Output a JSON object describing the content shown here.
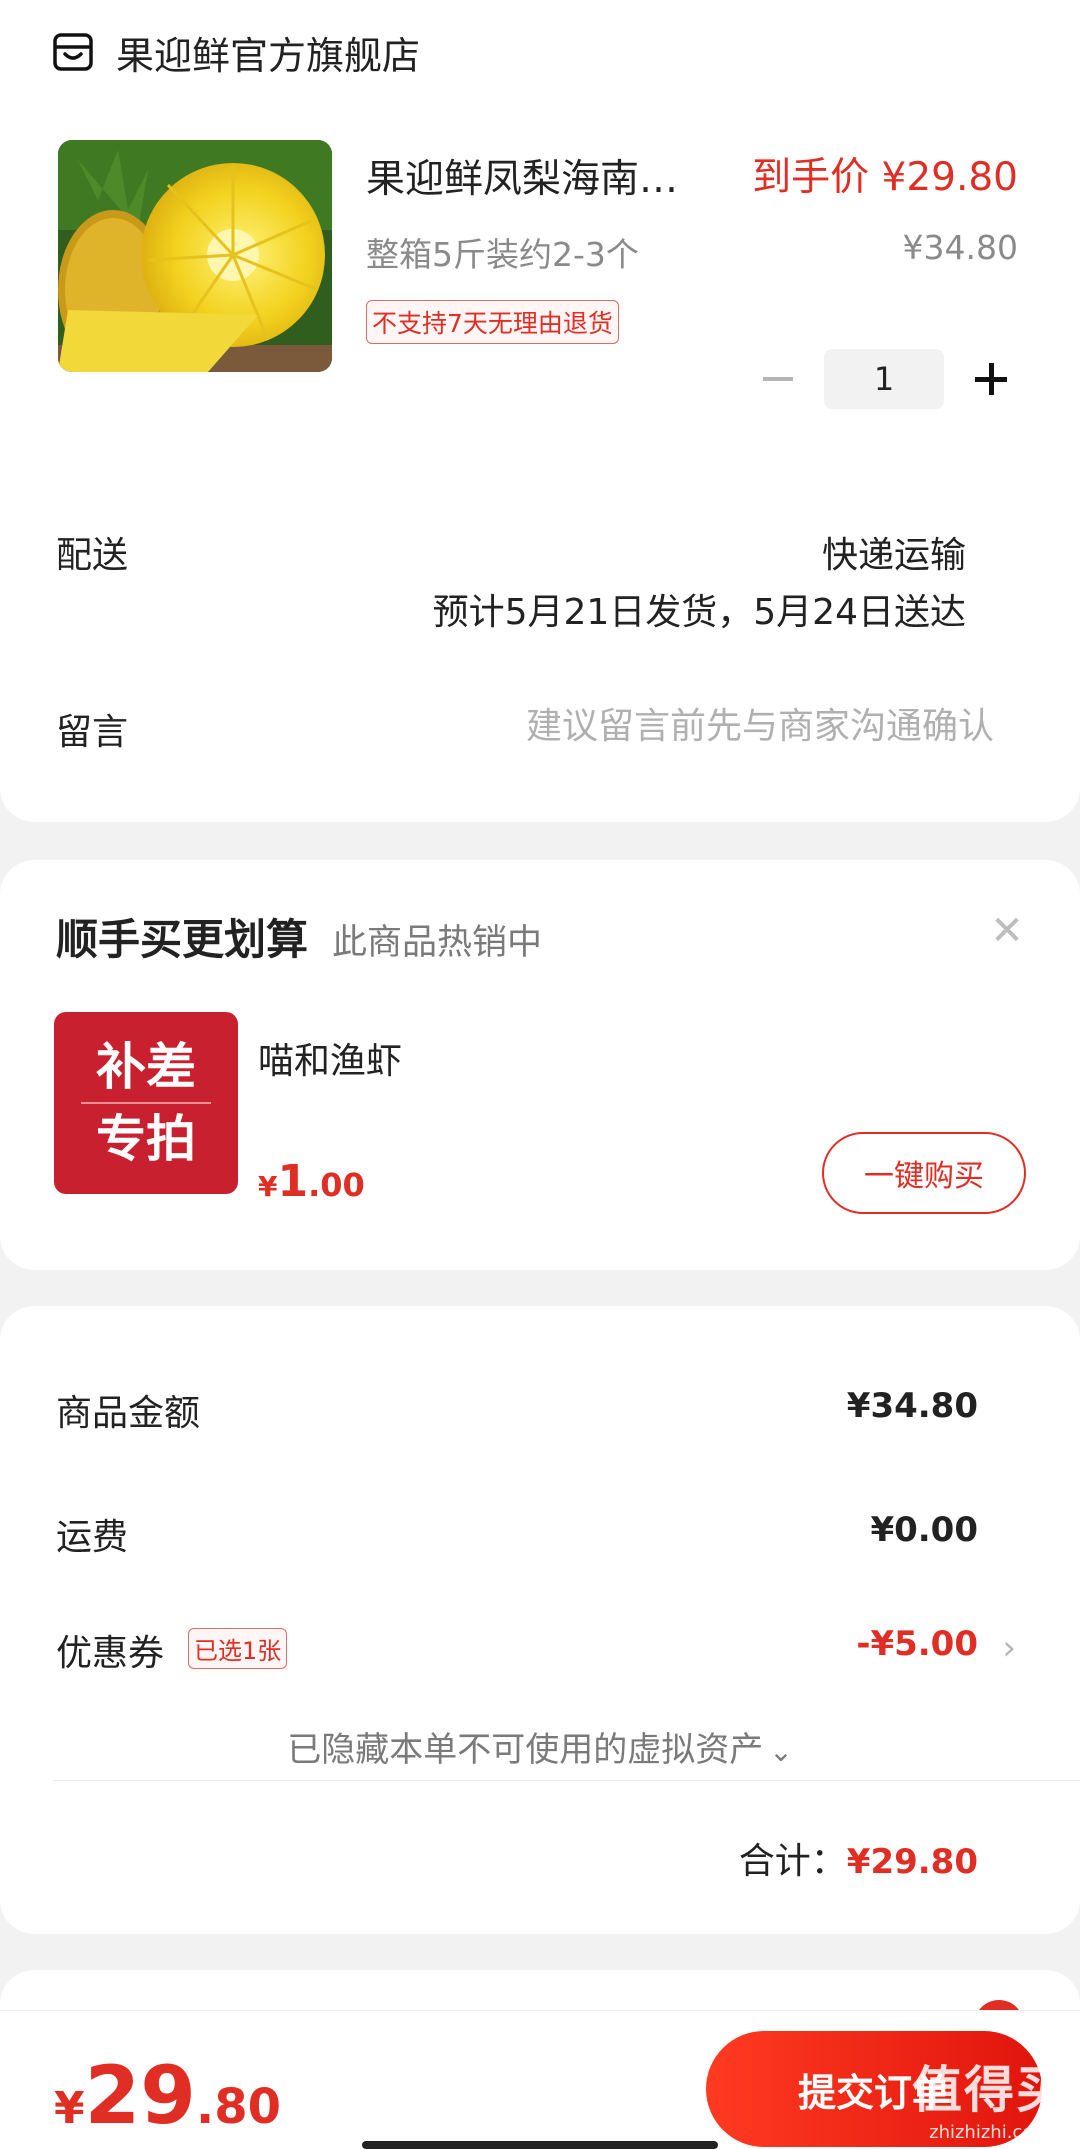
{
  "store": {
    "name": "果迎鲜官方旗舰店",
    "icon": "store-icon"
  },
  "product": {
    "title": "果迎鲜凤梨海南…",
    "final_price": "到手价 ¥29.80",
    "spec": "整箱5斤装约2-3个",
    "original_price": "¥34.80",
    "tag": "不支持7天无理由退货",
    "quantity": "1"
  },
  "delivery": {
    "label": "配送",
    "method": "快递运输",
    "estimate": "预计5月21日发货，5月24日送达"
  },
  "message": {
    "label": "留言",
    "placeholder": "建议留言前先与商家沟通确认"
  },
  "upsell": {
    "title": "顺手买更划算",
    "subtitle": "此商品热销中",
    "thumb_line1": "补差",
    "thumb_line2": "专拍",
    "item_name": "喵和渔虾",
    "price_currency": "¥",
    "price_int": "1",
    "price_dec": ".00",
    "button": "一键购买"
  },
  "summary": {
    "goods_label": "商品金额",
    "goods_value": "¥34.80",
    "shipping_label": "运费",
    "shipping_value": "¥0.00",
    "coupon_label": "优惠券",
    "coupon_tag": "已选1张",
    "coupon_value": "-¥5.00",
    "hidden_note": "已隐藏本单不可使用的虚拟资产",
    "total_label": "合计：",
    "total_value": "¥29.80"
  },
  "bottom": {
    "currency": "¥",
    "amount_int": "29",
    "amount_dec": ".80",
    "submit": "提交订单"
  },
  "watermark": {
    "big": "值得买",
    "small": "zhizhizhi.com"
  },
  "colors": {
    "accent": "#e02e24",
    "muted": "#8a8a8a",
    "background": "#f2f2f2"
  }
}
